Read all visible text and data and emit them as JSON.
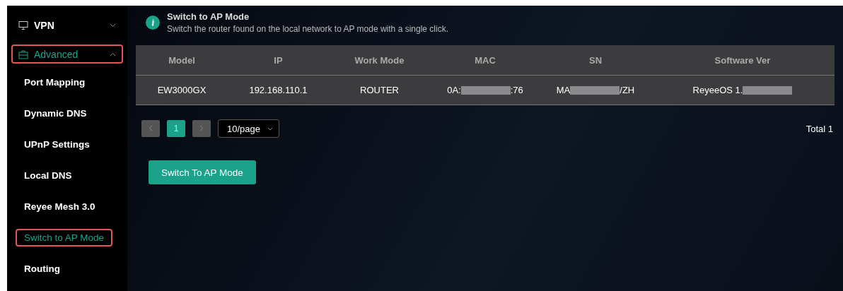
{
  "sidebar": {
    "items": [
      {
        "label": "VPN",
        "expanded": false,
        "selected": false,
        "highlighted": false
      },
      {
        "label": "Advanced",
        "expanded": true,
        "selected": true,
        "highlighted": true,
        "children": [
          {
            "label": "Port Mapping",
            "selected": false,
            "highlighted": false
          },
          {
            "label": "Dynamic DNS",
            "selected": false,
            "highlighted": false
          },
          {
            "label": "UPnP Settings",
            "selected": false,
            "highlighted": false
          },
          {
            "label": "Local DNS",
            "selected": false,
            "highlighted": false
          },
          {
            "label": "Reyee Mesh 3.0",
            "selected": false,
            "highlighted": false
          },
          {
            "label": "Switch to AP Mode",
            "selected": true,
            "highlighted": true
          },
          {
            "label": "Routing",
            "selected": false,
            "highlighted": false
          }
        ]
      }
    ]
  },
  "notice": {
    "title": "Switch to AP Mode",
    "text": "Switch the router found on the local network to AP mode with a single click."
  },
  "table": {
    "columns": [
      "Model",
      "IP",
      "Work Mode",
      "MAC",
      "SN",
      "Software Ver"
    ],
    "rows": [
      [
        {
          "text": "EW3000GX",
          "redacted": false
        },
        {
          "text": "192.168.110.1",
          "redacted": false
        },
        {
          "text": "ROUTER",
          "redacted": false
        },
        {
          "text": "0A:",
          "after": ":76",
          "redacted": true
        },
        {
          "text": "MA",
          "after": "/ZH",
          "redacted": true
        },
        {
          "text": "ReyeeOS 1.",
          "redacted": true
        }
      ]
    ]
  },
  "pagination": {
    "pages": [
      {
        "label": "1",
        "selected": true
      }
    ],
    "page_size": "10/page",
    "total": "Total 1"
  },
  "action_button": "Switch To AP Mode"
}
